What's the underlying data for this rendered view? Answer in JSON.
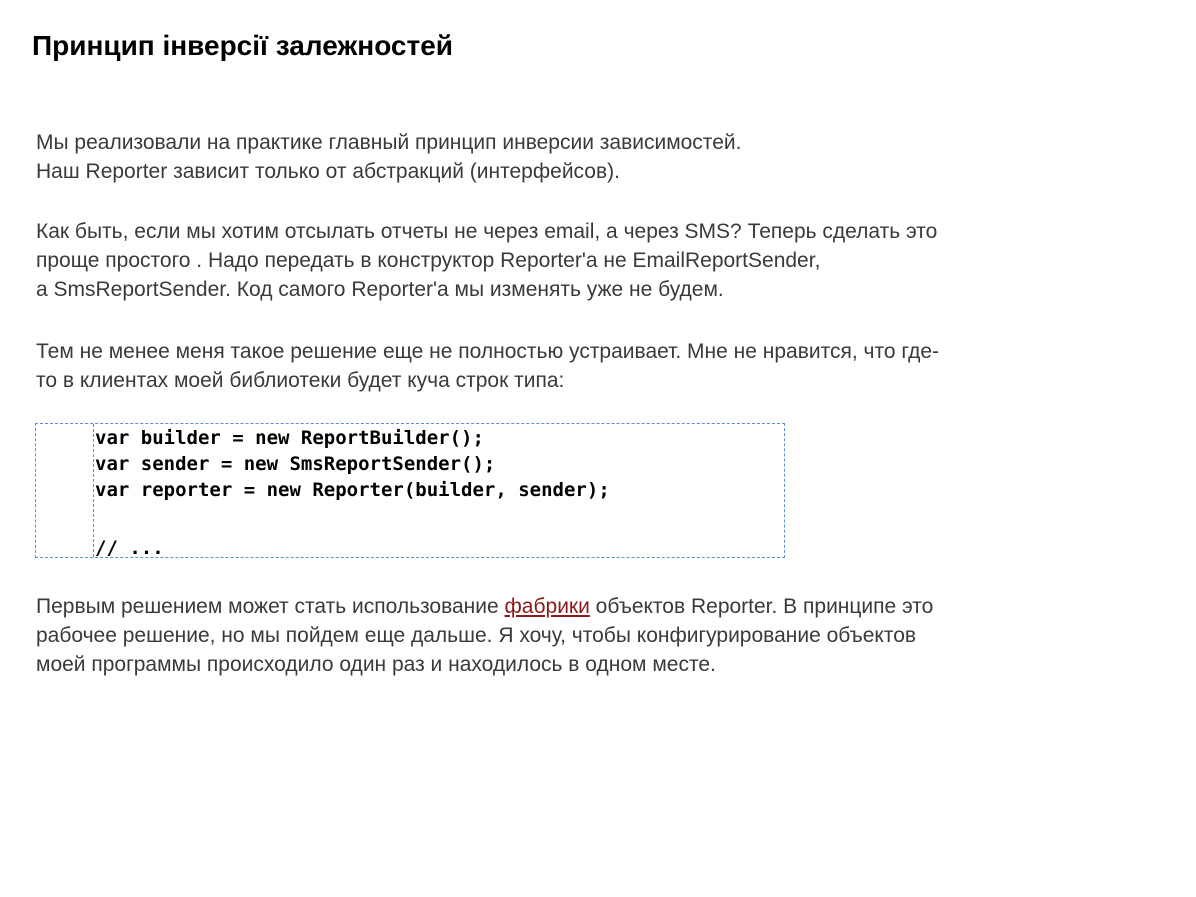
{
  "title": "Принцип інверсії залежностей",
  "paragraph1": [
    "Мы реализовали на практике главный принцип инверсии зависимостей.",
    "Наш Reporter зависит только от абстракций (интерфейсов)."
  ],
  "paragraph2": [
    "Как быть, если мы хотим отсылать отчеты не через email, а через SMS? Теперь сделать это",
    "проще простого . Надо передать в конструктор Reporter'a не EmailReportSender,",
    "а SmsReportSender. Код самого Reporter'a мы изменять уже не будем."
  ],
  "paragraph3": [
    "Тем не менее меня такое решение еще не полностью устраивает. Мне не нравится, что где-",
    "то в клиентах моей библиотеки будет куча строк типа:"
  ],
  "code": [
    "var builder = new ReportBuilder();",
    "var sender = new SmsReportSender();",
    "var reporter = new Reporter(builder, sender);",
    "",
    "// ..."
  ],
  "paragraph4": {
    "line1_before": "Первым решением может стать использование ",
    "line1_link": "фабрики",
    "line1_after": " объектов Reporter. В принципе это",
    "line2": "рабочее решение, но мы пойдем еще дальше. Я хочу, чтобы конфигурирование объектов",
    "line3": "моей программы происходило один раз и находилось в одном месте."
  },
  "colors": {
    "link": "#8b1a1a",
    "code_border": "#5b8fd6",
    "body_text": "#3a3a3a"
  }
}
